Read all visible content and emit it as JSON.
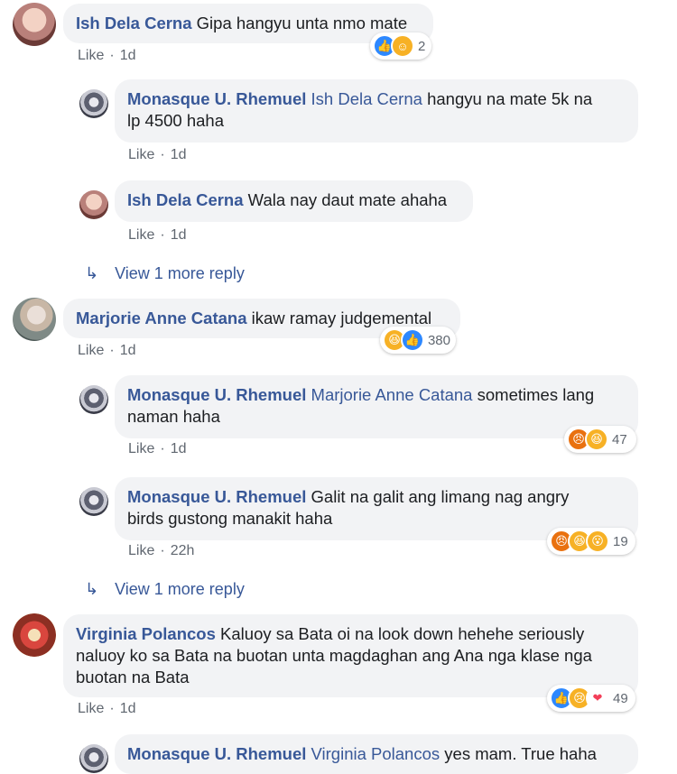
{
  "comments": [
    {
      "author": "Ish Dela Cerna",
      "text": "Gipa hangyu unta nmo mate",
      "like_label": "Like",
      "time": "1d",
      "reaction_count": "2"
    },
    {
      "author": "Monasque U. Rhemuel",
      "tag": "Ish Dela Cerna",
      "text_line1": "hangyu na mate 5k na",
      "text_line2": "lp 4500 haha",
      "like_label": "Like",
      "time": "1d"
    },
    {
      "author": "Ish Dela Cerna",
      "text": "Wala nay daut mate ahaha",
      "like_label": "Like",
      "time": "1d"
    },
    {
      "author": "Marjorie Anne Catana",
      "text": "ikaw ramay judgemental",
      "like_label": "Like",
      "time": "1d",
      "reaction_count": "380"
    },
    {
      "author": "Monasque U. Rhemuel",
      "tag": "Marjorie Anne Catana",
      "text_line1": "sometimes lang",
      "text_line2": "naman haha",
      "like_label": "Like",
      "time": "1d",
      "reaction_count": "47"
    },
    {
      "author": "Monasque U. Rhemuel",
      "text_line1": "Galit na galit ang limang nag angry",
      "text_line2": "birds gustong manakit haha",
      "like_label": "Like",
      "time": "22h",
      "reaction_count": "19"
    },
    {
      "author": "Virginia Polancos",
      "text_line1": "Kaluoy sa Bata oi na look down hehehe seriously",
      "text_line2": "naluoy ko sa Bata na buotan unta magdaghan ang Ana nga klase nga",
      "text_line3": "buotan na Bata",
      "like_label": "Like",
      "time": "1d",
      "reaction_count": "49"
    },
    {
      "author": "Monasque U. Rhemuel",
      "tag": "Virginia Polancos",
      "text": "yes mam. True haha"
    }
  ],
  "view_more_1": "View 1 more reply",
  "view_more_2": "View 1 more reply",
  "separator": "·",
  "colors": {
    "link": "#385898",
    "bubble": "#f2f3f5",
    "meta": "#606770"
  }
}
